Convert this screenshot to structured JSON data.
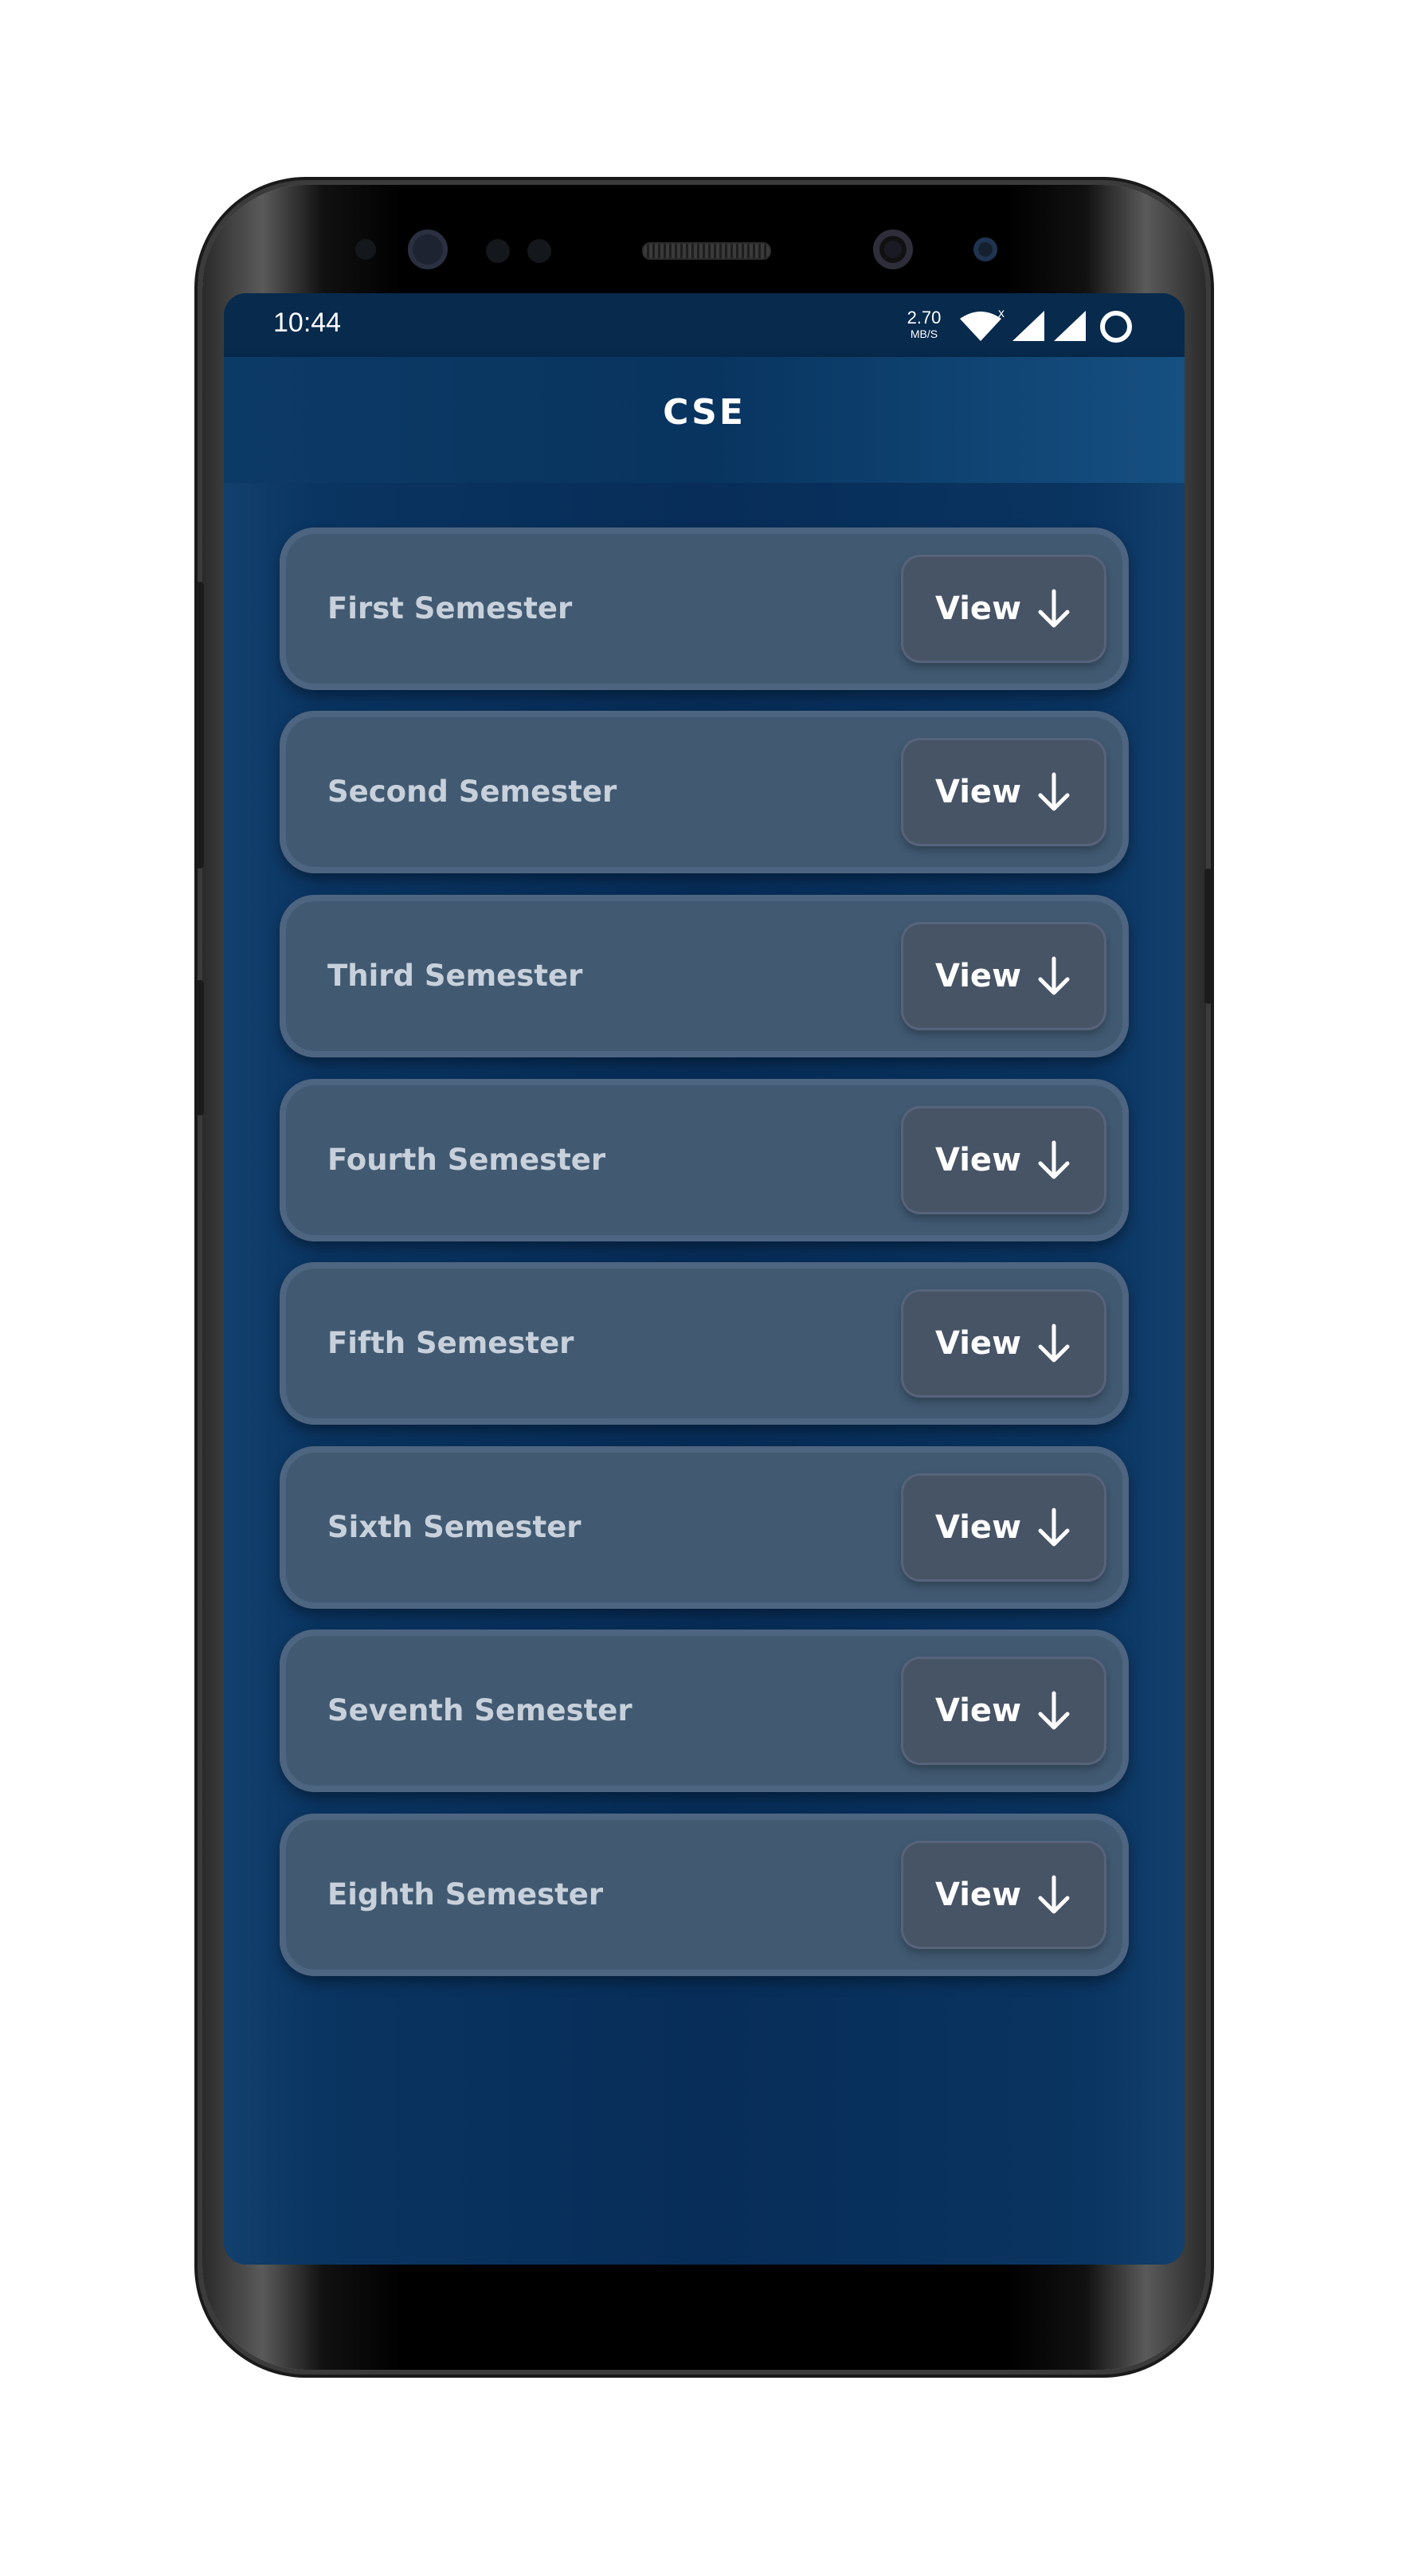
{
  "status_bar": {
    "time": "10:44",
    "net_speed": "2.70",
    "net_speed_unit": "MB/S",
    "icons": [
      "wifi-icon",
      "signal-icon",
      "signal-icon",
      "battery-ring-icon"
    ]
  },
  "app_bar": {
    "title": "CSE"
  },
  "semesters": [
    {
      "label": "First Semester",
      "button": "View"
    },
    {
      "label": "Second Semester",
      "button": "View"
    },
    {
      "label": "Third Semester",
      "button": "View"
    },
    {
      "label": "Fourth Semester",
      "button": "View"
    },
    {
      "label": "Fifth Semester",
      "button": "View"
    },
    {
      "label": "Sixth Semester",
      "button": "View"
    },
    {
      "label": "Seventh Semester",
      "button": "View"
    },
    {
      "label": "Eighth Semester",
      "button": "View"
    }
  ],
  "colors": {
    "app_background": "#083059",
    "card": "#415a72",
    "button": "#475466",
    "text": "#ffffff"
  }
}
